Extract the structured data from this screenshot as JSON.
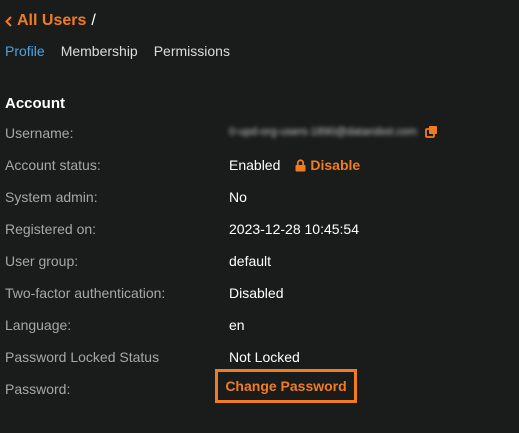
{
  "breadcrumb": {
    "back_label": "All Users",
    "separator": "/"
  },
  "tabs": [
    {
      "label": "Profile",
      "active": true
    },
    {
      "label": "Membership",
      "active": false
    },
    {
      "label": "Permissions",
      "active": false
    }
  ],
  "account": {
    "title": "Account",
    "rows": [
      {
        "label": "Username:",
        "value": "0-upd-org-users-1890@datarobot.com"
      },
      {
        "label": "Account status:",
        "value": "Enabled",
        "action": "Disable"
      },
      {
        "label": "System admin:",
        "value": "No"
      },
      {
        "label": "Registered on:",
        "value": "2023-12-28 10:45:54"
      },
      {
        "label": "User group:",
        "value": "default"
      },
      {
        "label": "Two-factor authentication:",
        "value": "Disabled"
      },
      {
        "label": "Language:",
        "value": "en"
      },
      {
        "label": "Password Locked Status",
        "value": "Not Locked"
      },
      {
        "label": "Password:",
        "value": ""
      }
    ]
  },
  "change_password_label": "Change Password",
  "icons": {
    "back": "chevron-left-icon",
    "copy": "copy-icon",
    "lock": "lock-icon"
  },
  "colors": {
    "background": "#1a1c1c",
    "accent": "#f07c22",
    "tab_active": "#4da3e0",
    "label": "#a5a8a8",
    "value": "#ffffff"
  }
}
